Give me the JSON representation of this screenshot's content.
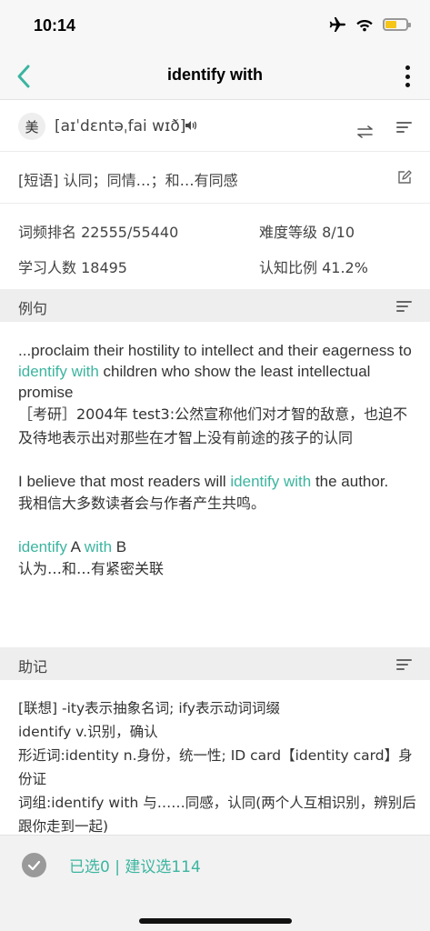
{
  "status_bar": {
    "time": "10:14"
  },
  "nav": {
    "title": "identify with"
  },
  "phonetic": {
    "region": "美",
    "ipa": "[aɪˈdɛntəˌfai wɪð]"
  },
  "definition": {
    "text": "[短语] 认同；同情…；和…有同感"
  },
  "stats": {
    "freq_rank": "词频排名 22555/55440",
    "difficulty": "难度等级 8/10",
    "learners": "学习人数 18495",
    "known_ratio": "认知比例 41.2%"
  },
  "examples_section": {
    "title": "例句"
  },
  "examples": {
    "ex1": {
      "pre": "...proclaim their hostility to intellect and their eagerness to ",
      "hl": "identify with",
      "post": " children who show the least intellectual promise",
      "zh": "［考研］2004年 test3:公然宣称他们对才智的敌意，也迫不及待地表示出对那些在才智上没有前途的孩子的认同"
    },
    "ex2": {
      "pre": "I believe that most readers will ",
      "hl": "identify with",
      "post": " the author.",
      "zh": "我相信大多数读者会与作者产生共鸣。"
    },
    "ex3": {
      "hl1": "identify",
      "mid1": " A ",
      "hl2": "with",
      "mid2": " B",
      "zh": "认为…和…有紧密关联"
    }
  },
  "mnemonic_section": {
    "title": "助记"
  },
  "mnemonic": {
    "line1": "[联想] -ity表示抽象名词; ify表示动词词缀",
    "line2": "identify v.识别，确认",
    "line3": "形近词:identity n.身份，统一性; ID card【identity card】身份证",
    "line4": "词组:identify with 与……同感，认同(两个人互相识别，辨别后跟你走到一起)"
  },
  "bottom": {
    "selection": "已选0 | 建议选114"
  },
  "colors": {
    "accent": "#3cb5a0",
    "section_bg": "#eeeeee",
    "bottom_bg": "#f2f2f2"
  }
}
